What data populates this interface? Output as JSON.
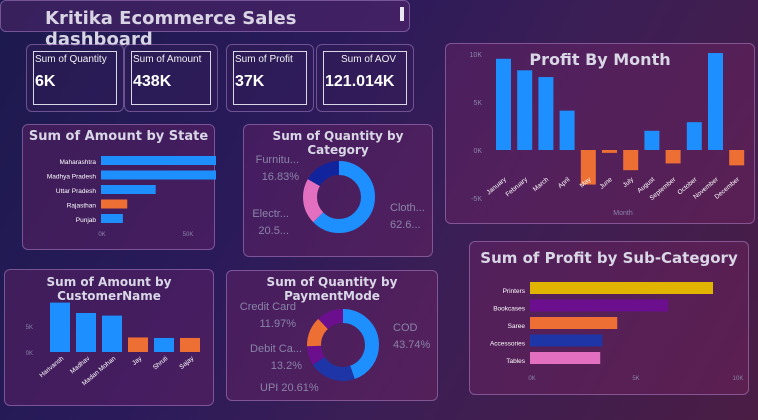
{
  "dashboard": {
    "title": "Kritika Ecommerce Sales dashboard"
  },
  "kpis": [
    {
      "label": "Sum of Quantity",
      "value": "6K"
    },
    {
      "label": "Sum of Amount",
      "value": "438K"
    },
    {
      "label": "Sum of Profit",
      "value": "37K"
    },
    {
      "label": "Sum of AOV",
      "value": "121.014K"
    }
  ],
  "chart_data": [
    {
      "id": "amount_by_state",
      "type": "bar",
      "orientation": "horizontal",
      "title": "Sum of Amount by State",
      "categories": [
        "Maharashtra",
        "Madhya Pradesh",
        "Uttar Pradesh",
        "Rajasthan",
        "Punjab"
      ],
      "values": [
        63000,
        58000,
        25000,
        12000,
        10000
      ],
      "colors": [
        "#1e8fff",
        "#1e8fff",
        "#1e8fff",
        "#ee6f33",
        "#1e8fff"
      ],
      "xticks": [
        "0K",
        "50K"
      ],
      "xlim": [
        0,
        80000
      ]
    },
    {
      "id": "quantity_by_category",
      "type": "pie",
      "donut": true,
      "title": "Sum of Quantity by Category",
      "slices": [
        {
          "label": "Clothing",
          "display": "Cloth...",
          "pct_label": "62.6...",
          "value": 62.6,
          "color": "#1e8fff"
        },
        {
          "label": "Electronics",
          "display": "Electr...",
          "pct_label": "20.5...",
          "value": 20.57,
          "color": "#e36fc0"
        },
        {
          "label": "Furniture",
          "display": "Furnitu...",
          "pct_label": "16.83%",
          "value": 16.83,
          "color": "#12239e"
        }
      ]
    },
    {
      "id": "profit_by_month",
      "type": "bar",
      "title": "Profit By Month",
      "xlabel": "Month",
      "categories": [
        "January",
        "February",
        "March",
        "April",
        "May",
        "June",
        "July",
        "August",
        "September",
        "October",
        "November",
        "December"
      ],
      "values": [
        9500,
        8300,
        7600,
        4100,
        -3600,
        -300,
        -2100,
        2000,
        -1400,
        2900,
        10100,
        -1600
      ],
      "positive_color": "#1e8fff",
      "negative_color": "#ee6f33",
      "yticks": [
        "15K",
        "10K",
        "5K",
        "0K",
        "-5K"
      ],
      "ylim": [
        -5000,
        15000
      ]
    },
    {
      "id": "amount_by_customer",
      "type": "bar",
      "title": "Sum of Amount by CustomerName",
      "categories": [
        "Harivansh",
        "Madhav",
        "Madan Mohan",
        "Jay",
        "Shruti",
        "Sajay"
      ],
      "values": [
        9500,
        7500,
        7000,
        2800,
        2700,
        2700
      ],
      "colors": [
        "#1e8fff",
        "#1e8fff",
        "#1e8fff",
        "#ee6f33",
        "#1e8fff",
        "#ee6f33"
      ],
      "yticks": [
        "5K",
        "0K"
      ],
      "ylim": [
        0,
        10000
      ]
    },
    {
      "id": "quantity_by_paymentmode",
      "type": "pie",
      "donut": true,
      "title": "Sum of Quantity by PaymentMode",
      "slices": [
        {
          "label": "COD",
          "display": "COD",
          "pct_label": "43.74%",
          "value": 43.74,
          "color": "#1e8fff"
        },
        {
          "label": "UPI",
          "display": "UPI",
          "pct_label": "20.61%",
          "value": 20.61,
          "color": "#1d35a6"
        },
        {
          "label": "EMI",
          "display": "",
          "pct_label": "",
          "value": 8.48,
          "color": "#6b0f8e"
        },
        {
          "label": "Debit Card",
          "display": "Debit Ca...",
          "pct_label": "13.2%",
          "value": 13.2,
          "color": "#ee6f33"
        },
        {
          "label": "Credit Card",
          "display": "Credit Card",
          "pct_label": "11.97%",
          "value": 11.97,
          "color": "#6b0f8e"
        }
      ]
    },
    {
      "id": "profit_by_subcategory",
      "type": "bar",
      "orientation": "horizontal",
      "title": "Sum of Profit by Sub-Category",
      "categories": [
        "Printers",
        "Bookcases",
        "Saree",
        "Accessories",
        "Tables"
      ],
      "values": [
        8600,
        6500,
        4100,
        3400,
        3300
      ],
      "colors": [
        "#e0b400",
        "#6b0f8e",
        "#ee6f33",
        "#1d35a6",
        "#e36fc0"
      ],
      "xticks": [
        "0K",
        "5K",
        "10K"
      ],
      "xlim": [
        0,
        10000
      ]
    }
  ]
}
